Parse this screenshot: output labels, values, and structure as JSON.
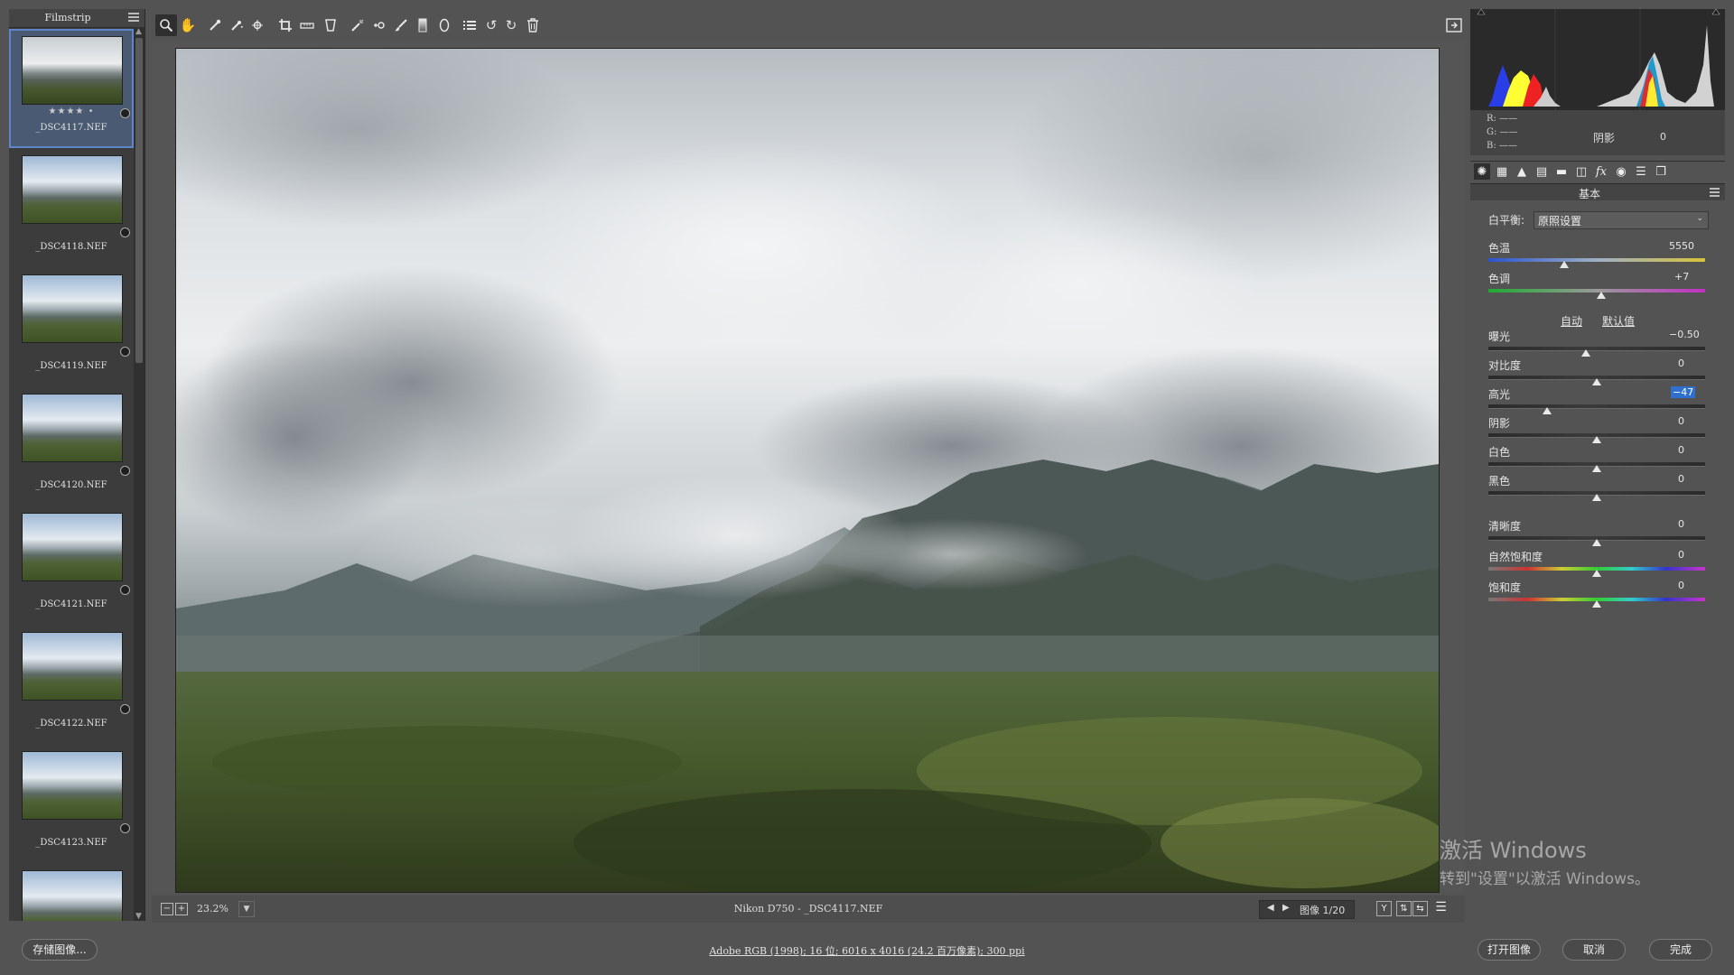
{
  "filmstrip": {
    "title": "Filmstrip",
    "items": [
      {
        "name": "_DSC4117.NEF",
        "stars": "★★★★ •",
        "selected": true
      },
      {
        "name": "_DSC4118.NEF",
        "stars": ""
      },
      {
        "name": "_DSC4119.NEF",
        "stars": ""
      },
      {
        "name": "_DSC4120.NEF",
        "stars": ""
      },
      {
        "name": "_DSC4121.NEF",
        "stars": ""
      },
      {
        "name": "_DSC4122.NEF",
        "stars": ""
      },
      {
        "name": "_DSC4123.NEF",
        "stars": ""
      },
      {
        "name": "",
        "stars": ""
      }
    ]
  },
  "toolbar": {
    "tools": [
      "zoom-tool",
      "hand-tool",
      "white-balance-tool",
      "color-sampler-tool",
      "targeted-adjustment-tool",
      "crop-tool",
      "straighten-tool",
      "transform-tool",
      "spot-removal-tool",
      "red-eye-tool",
      "adjustment-brush-tool",
      "graduated-filter-tool",
      "radial-filter-tool",
      "preferences-tool",
      "rotate-left-tool",
      "rotate-right-tool",
      "delete-tool"
    ],
    "active_tool": "zoom-tool"
  },
  "statusbar": {
    "zoom": "23.2%",
    "file_info": "Nikon D750 -  _DSC4117.NEF",
    "image_count": "图像 1/20"
  },
  "histogram": {
    "r_label": "R:  ——",
    "g_label": "G:  ——",
    "b_label": "B:  ——",
    "readout_name": "阴影",
    "readout_value": "0"
  },
  "panel": {
    "title": "基本",
    "white_balance": {
      "label": "白平衡:",
      "value": "原照设置"
    },
    "temperature": {
      "label": "色温",
      "value": "5550",
      "level": 0.35
    },
    "tint": {
      "label": "色调",
      "value": "+7",
      "level": 0.52
    },
    "auto_label": "自动",
    "default_label": "默认值",
    "sliders": [
      {
        "key": "exposure",
        "label": "曝光",
        "value": "−0.50",
        "level": 0.45
      },
      {
        "key": "contrast",
        "label": "对比度",
        "value": "0",
        "level": 0.5
      },
      {
        "key": "highlights",
        "label": "高光",
        "value": "−47",
        "level": 0.27,
        "selected": true
      },
      {
        "key": "shadows",
        "label": "阴影",
        "value": "0",
        "level": 0.5
      },
      {
        "key": "whites",
        "label": "白色",
        "value": "0",
        "level": 0.5
      },
      {
        "key": "blacks",
        "label": "黑色",
        "value": "0",
        "level": 0.5
      },
      {
        "key": "clarity",
        "label": "清晰度",
        "value": "0",
        "level": 0.5
      },
      {
        "key": "vibrance",
        "label": "自然饱和度",
        "value": "0",
        "level": 0.5
      },
      {
        "key": "saturation",
        "label": "饱和度",
        "value": "0",
        "level": 0.5
      }
    ]
  },
  "bottom": {
    "save_label": "存储图像...",
    "workflow": "Adobe RGB (1998); 16 位; 6016 x 4016 (24.2 百万像素); 300 ppi",
    "open_label": "打开图像",
    "cancel_label": "取消",
    "done_label": "完成"
  },
  "watermark": {
    "title": "激活 Windows",
    "subtitle": "转到\"设置\"以激活 Windows。"
  }
}
